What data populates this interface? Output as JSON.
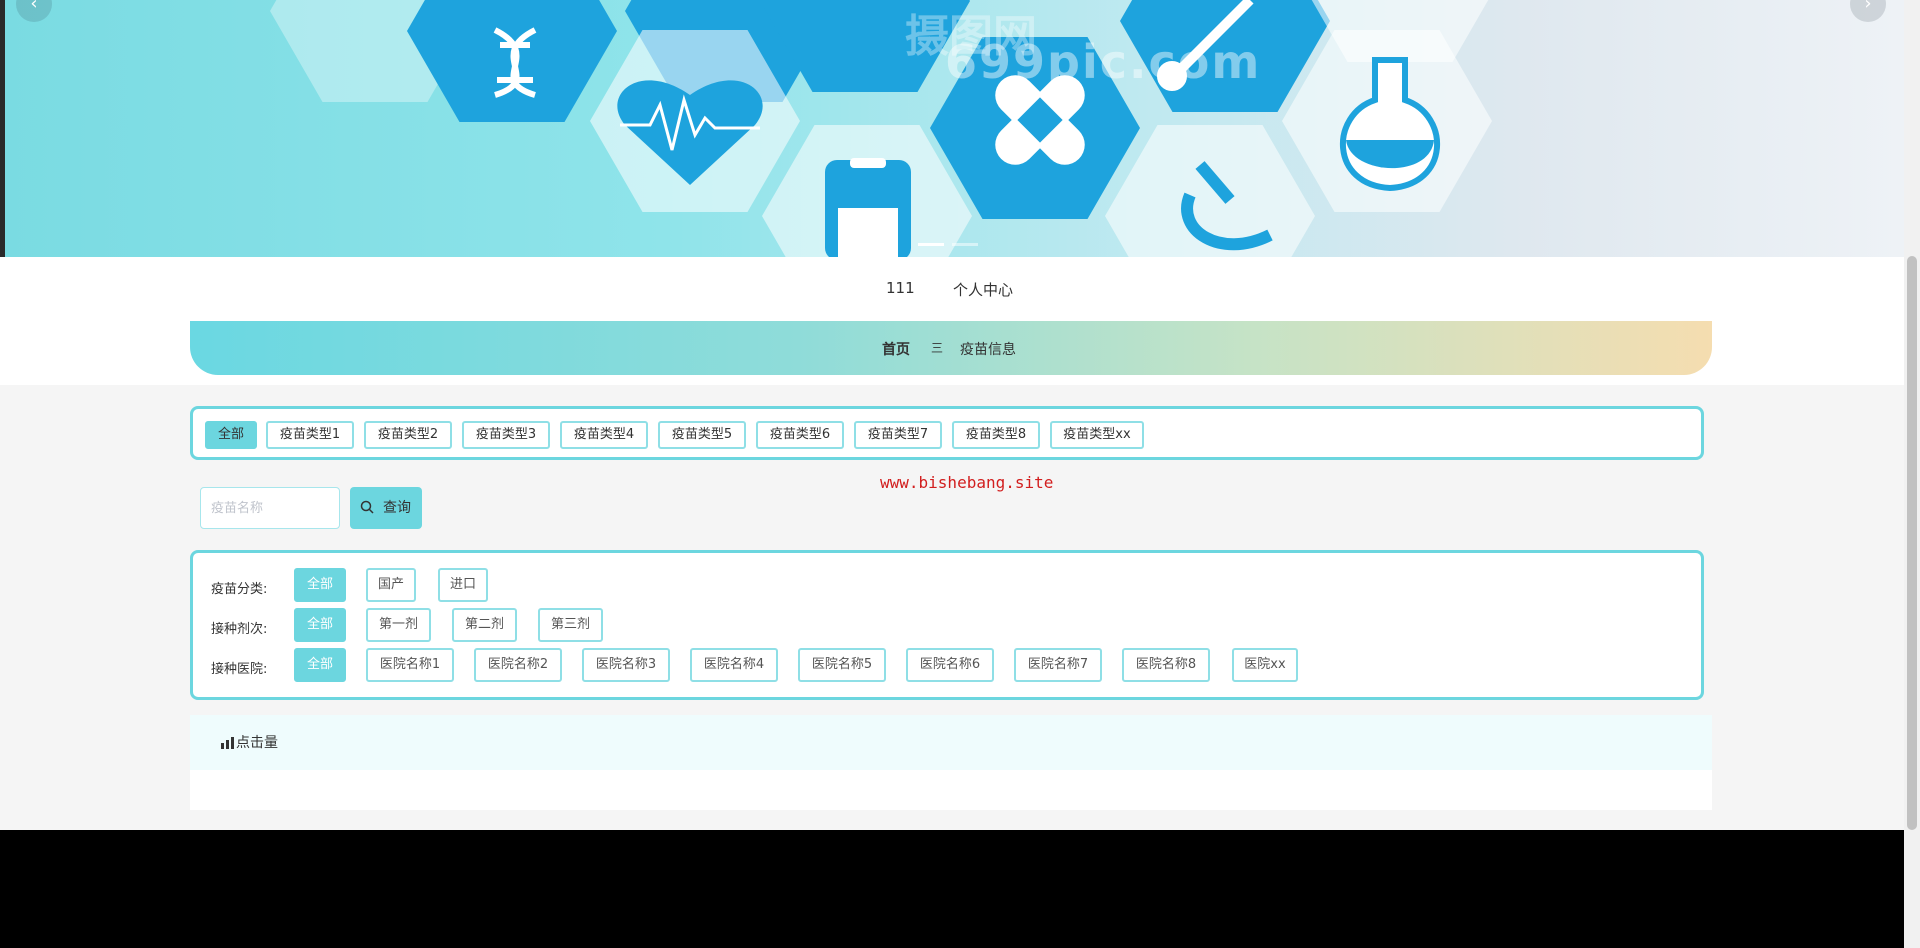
{
  "banner": {
    "watermark_main": "摄图网",
    "watermark_sub": "699pic.com",
    "prev_icon": "‹",
    "next_icon": "›"
  },
  "userbar": {
    "username": "111",
    "personal_center": "个人中心"
  },
  "breadcrumb": {
    "home": "首页",
    "separator": "三",
    "current": "疫苗信息"
  },
  "category_tabs": [
    {
      "label": "全部",
      "active": true
    },
    {
      "label": "疫苗类型1"
    },
    {
      "label": "疫苗类型2"
    },
    {
      "label": "疫苗类型3"
    },
    {
      "label": "疫苗类型4"
    },
    {
      "label": "疫苗类型5"
    },
    {
      "label": "疫苗类型6"
    },
    {
      "label": "疫苗类型7"
    },
    {
      "label": "疫苗类型8"
    },
    {
      "label": "疫苗类型xx"
    }
  ],
  "site_watermark": "www.bishebang.site",
  "search": {
    "placeholder": "疫苗名称",
    "value": "",
    "button_label": "查询"
  },
  "filters": {
    "vaccine_category": {
      "label": "疫苗分类:",
      "options": [
        "全部",
        "国产",
        "进口"
      ],
      "selected": "全部"
    },
    "dose": {
      "label": "接种剂次:",
      "options": [
        "全部",
        "第一剂",
        "第二剂",
        "第三剂"
      ],
      "selected": "全部"
    },
    "hospital": {
      "label": "接种医院:",
      "options": [
        "全部",
        "医院名称1",
        "医院名称2",
        "医院名称3",
        "医院名称4",
        "医院名称5",
        "医院名称6",
        "医院名称7",
        "医院名称8",
        "医院xx"
      ],
      "selected": "全部"
    }
  },
  "sort": {
    "icon": "bar-chart-icon",
    "label": "点击量"
  },
  "colors": {
    "accent": "#6cd6df",
    "accent_border": "#8fdfe6",
    "watermark_red": "#d21e1e"
  }
}
